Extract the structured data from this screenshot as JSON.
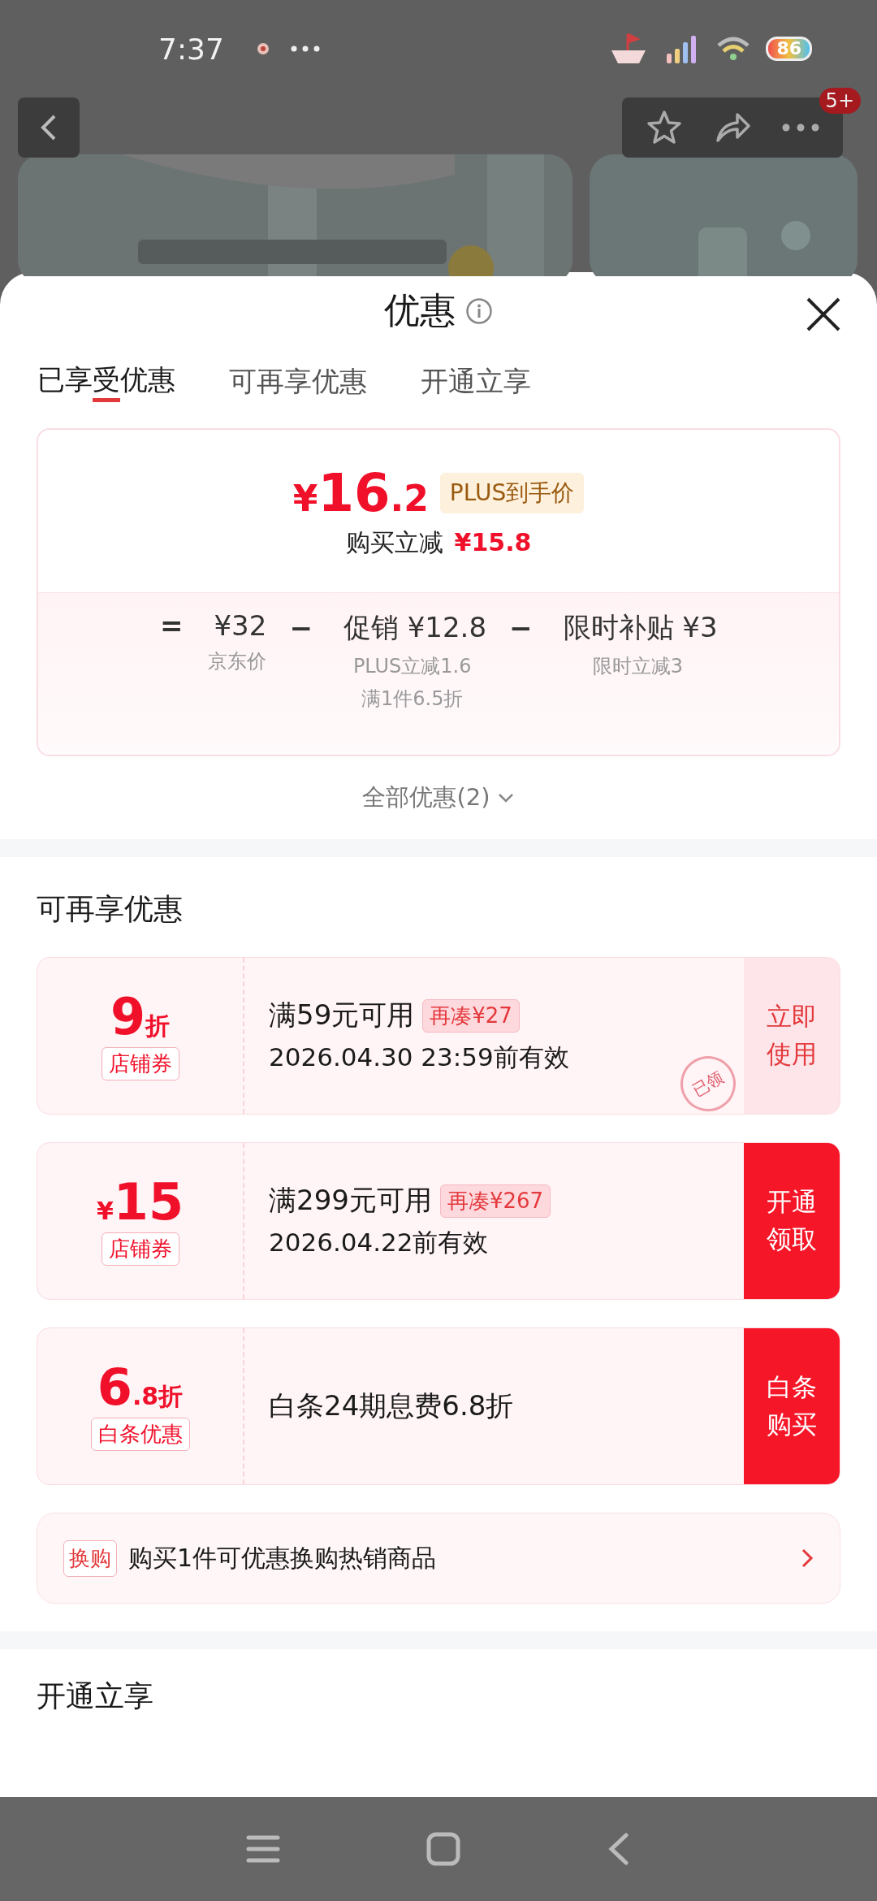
{
  "status_bar": {
    "time": "7:37",
    "battery": "86"
  },
  "header": {
    "badge": "5+"
  },
  "sheet": {
    "title": "优惠",
    "tabs": [
      {
        "label": "已享受优惠",
        "selected": true
      },
      {
        "label": "可再享优惠",
        "selected": false
      },
      {
        "label": "开通立享",
        "selected": false
      }
    ],
    "price_card": {
      "currency": "¥",
      "price": "16",
      "price_decimal": ".2",
      "price_tag": "PLUS到手价",
      "saving_label": "购买立减",
      "saving": "¥15.8",
      "breakdown": [
        {
          "op": "=",
          "amount": "¥32",
          "notes": [
            "京东价"
          ]
        },
        {
          "op": "−",
          "amount": "促销 ¥12.8",
          "notes": [
            "PLUS立减1.6",
            "满1件6.5折"
          ]
        },
        {
          "op": "−",
          "amount": "限时补贴 ¥3",
          "notes": [
            "限时立减3"
          ]
        }
      ]
    },
    "all_offers": "全部优惠(2)",
    "more_section": {
      "title": "可再享优惠",
      "coupons": [
        {
          "value": "9",
          "suffix": "折",
          "type_label": "店铺券",
          "condition": "满59元可用",
          "gap": "再凑¥27",
          "validity": "2026.04.30 23:59前有效",
          "stamp": "已领",
          "action": {
            "label": "立即使用",
            "kind": "outline"
          }
        },
        {
          "prefix": "¥",
          "value": "15",
          "type_label": "店铺券",
          "condition": "满299元可用",
          "gap": "再凑¥267",
          "validity": "2026.04.22前有效",
          "action": {
            "label": "开通领取",
            "kind": "filled"
          }
        },
        {
          "value": "6",
          "suffix": ".8折",
          "type_label": "白条优惠",
          "condition": "白条24期息费6.8折",
          "action": {
            "label": "白条购买",
            "kind": "filled"
          }
        }
      ],
      "exchange": {
        "tag": "换购",
        "text": "购买1件可优惠换购热销商品"
      }
    },
    "open_section": {
      "title": "开通立享"
    }
  }
}
